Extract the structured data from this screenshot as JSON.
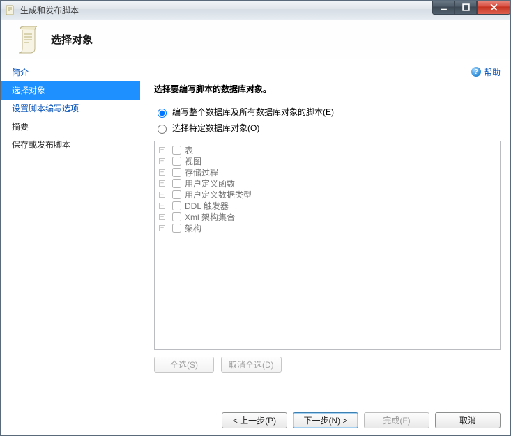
{
  "window": {
    "title": "生成和发布脚本"
  },
  "header": {
    "heading": "选择对象"
  },
  "help_link": "帮助",
  "sidebar": {
    "steps": [
      {
        "label": "简介",
        "kind": "link"
      },
      {
        "label": "选择对象",
        "kind": "active"
      },
      {
        "label": "设置脚本编写选项",
        "kind": "link"
      },
      {
        "label": "摘要",
        "kind": "plain"
      },
      {
        "label": "保存或发布脚本",
        "kind": "plain"
      }
    ]
  },
  "content": {
    "instruction": "选择要编写脚本的数据库对象。",
    "radio_all": "编写整个数据库及所有数据库对象的脚本(E)",
    "radio_specific": "选择特定数据库对象(O)",
    "radio_selected": "all",
    "tree_items": [
      "表",
      "视图",
      "存储过程",
      "用户定义函数",
      "用户定义数据类型",
      "DDL 触发器",
      "Xml 架构集合",
      "架构"
    ],
    "select_all": "全选(S)",
    "deselect_all": "取消全选(D)"
  },
  "footer": {
    "prev": "< 上一步(P)",
    "next": "下一步(N) >",
    "finish": "完成(F)",
    "cancel": "取消"
  }
}
